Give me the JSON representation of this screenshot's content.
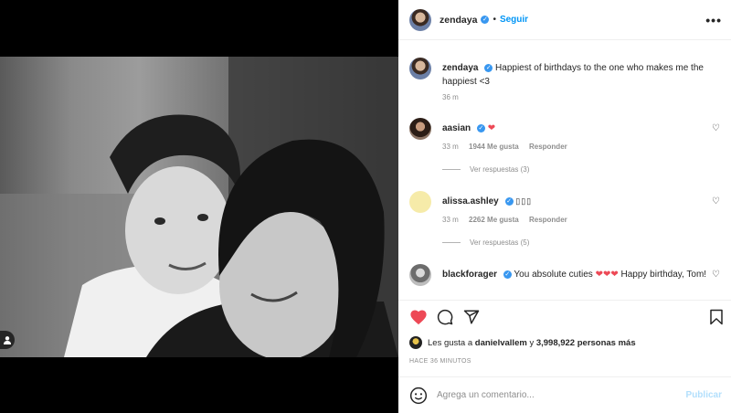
{
  "post": {
    "username": "zendaya",
    "follow_label": "Seguir",
    "more_label": "•••",
    "caption_user": "zendaya",
    "caption_text": "Happiest of birthdays to the one who makes me the happiest <3",
    "caption_time": "36 m"
  },
  "comments": [
    {
      "user": "aasian",
      "text": "❤",
      "time": "33 m",
      "likes": "1944 Me gusta",
      "reply": "Responder",
      "view_replies": "Ver respuestas (3)"
    },
    {
      "user": "alissa.ashley",
      "text": "",
      "time": "33 m",
      "likes": "2262 Me gusta",
      "reply": "Responder",
      "view_replies": "Ver respuestas (5)"
    },
    {
      "user": "blackforager",
      "text_pre": "You absolute cuties",
      "hearts": "❤❤❤",
      "text_post": "Happy birthday, Tom!"
    }
  ],
  "likes": {
    "prefix": "Les gusta a",
    "user": "danielvallem",
    "middle": "y",
    "count": "3,998,922 personas más"
  },
  "time_ago": "HACE 36 MINUTOS",
  "add_comment": {
    "placeholder": "Agrega un comentario...",
    "publish_label": "Publicar"
  },
  "icons": [
    "heart-icon",
    "comment-icon",
    "share-icon",
    "bookmark-icon",
    "emoji-icon",
    "user-tag-icon",
    "verified-badge"
  ],
  "colors": {
    "like_red": "#ed4956",
    "link_blue": "#0095f6",
    "publish_disabled": "#b2dffc"
  }
}
